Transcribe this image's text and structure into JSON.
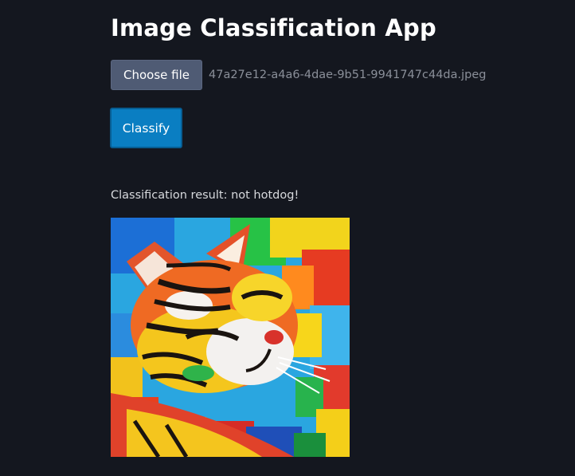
{
  "page": {
    "title": "Image Classification App"
  },
  "file_input": {
    "button_label": "Choose file",
    "selected_file": "47a27e12-a4a6-4dae-9b51-9941747c44da.jpeg"
  },
  "classify": {
    "button_label": "Classify"
  },
  "result": {
    "text": "Classification result: not hotdog!"
  },
  "preview": {
    "description_icon": "cat-painting-image"
  },
  "colors": {
    "background": "#14171f",
    "choose_button": "#4f5b74",
    "classify_button": "#0a7ec2",
    "text_muted": "#8a8f99"
  }
}
